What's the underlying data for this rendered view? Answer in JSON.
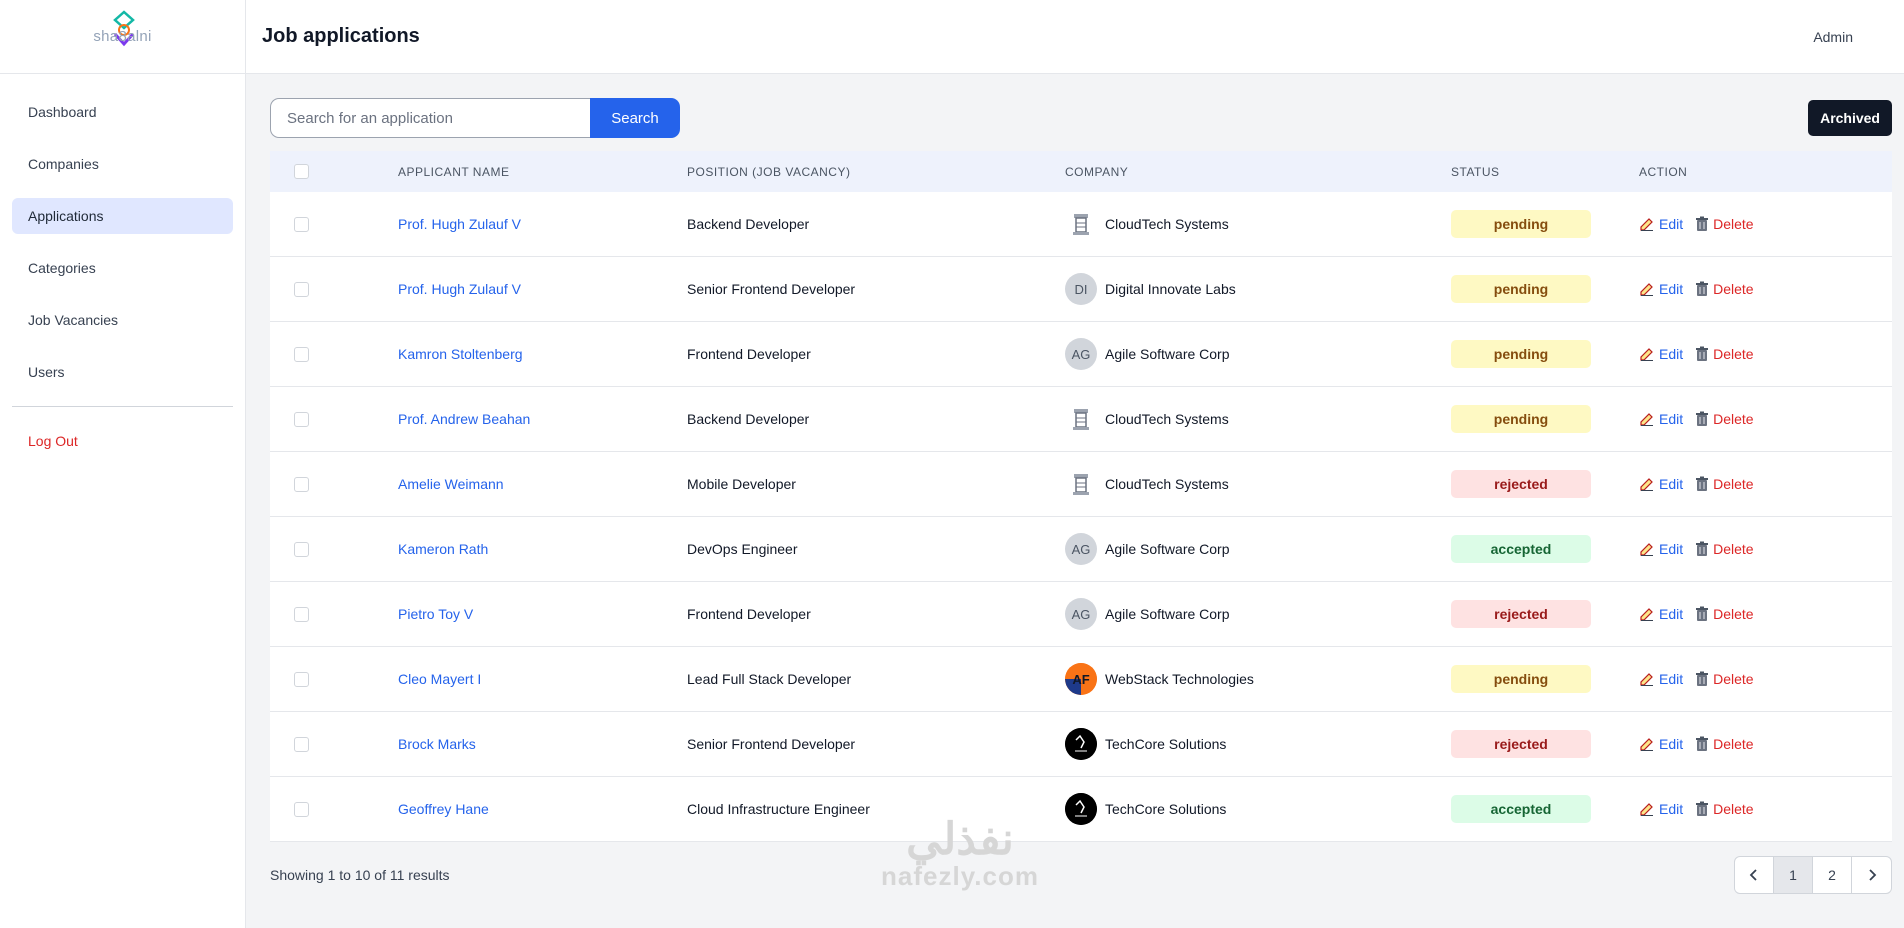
{
  "app": {
    "logo_text": "sha8alni",
    "page_title": "Job applications",
    "user": "Admin"
  },
  "sidebar": {
    "items": [
      {
        "label": "Dashboard"
      },
      {
        "label": "Companies"
      },
      {
        "label": "Applications",
        "active": true
      },
      {
        "label": "Categories"
      },
      {
        "label": "Job Vacancies"
      },
      {
        "label": "Users"
      }
    ],
    "logout_label": "Log Out"
  },
  "toolbar": {
    "search_placeholder": "Search for an application",
    "search_label": "Search",
    "archived_label": "Archived"
  },
  "table": {
    "headers": {
      "name": "APPLICANT NAME",
      "position": "POSITION (JOB VACANCY)",
      "company": "COMPANY",
      "status": "STATUS",
      "action": "ACTION"
    },
    "edit_label": "Edit",
    "delete_label": "Delete",
    "rows": [
      {
        "name": "Prof. Hugh Zulauf V",
        "position": "Backend Developer",
        "company": "CloudTech Systems",
        "logo": "ct",
        "status": "pending"
      },
      {
        "name": "Prof. Hugh Zulauf V",
        "position": "Senior Frontend Developer",
        "company": "Digital Innovate Labs",
        "logo": "DI",
        "status": "pending"
      },
      {
        "name": "Kamron Stoltenberg",
        "position": "Frontend Developer",
        "company": "Agile Software Corp",
        "logo": "AG",
        "status": "pending"
      },
      {
        "name": "Prof. Andrew Beahan",
        "position": "Backend Developer",
        "company": "CloudTech Systems",
        "logo": "ct",
        "status": "pending"
      },
      {
        "name": "Amelie Weimann",
        "position": "Mobile Developer",
        "company": "CloudTech Systems",
        "logo": "ct",
        "status": "rejected"
      },
      {
        "name": "Kameron Rath",
        "position": "DevOps Engineer",
        "company": "Agile Software Corp",
        "logo": "AG",
        "status": "accepted"
      },
      {
        "name": "Pietro Toy V",
        "position": "Frontend Developer",
        "company": "Agile Software Corp",
        "logo": "AG",
        "status": "rejected"
      },
      {
        "name": "Cleo Mayert I",
        "position": "Lead Full Stack Developer",
        "company": "WebStack Technologies",
        "logo": "ws",
        "status": "pending"
      },
      {
        "name": "Brock Marks",
        "position": "Senior Frontend Developer",
        "company": "TechCore Solutions",
        "logo": "tc",
        "status": "rejected"
      },
      {
        "name": "Geoffrey Hane",
        "position": "Cloud Infrastructure Engineer",
        "company": "TechCore Solutions",
        "logo": "tc",
        "status": "accepted"
      }
    ]
  },
  "footer": {
    "results_text": "Showing 1 to 10 of 11 results",
    "pages": [
      "1",
      "2"
    ],
    "current_page": "1"
  },
  "watermark": {
    "text_ar": "نفذلي",
    "text_en": "nafezly.com"
  },
  "colors": {
    "primary": "#2563eb",
    "danger": "#dc2626",
    "dark": "#111827"
  }
}
